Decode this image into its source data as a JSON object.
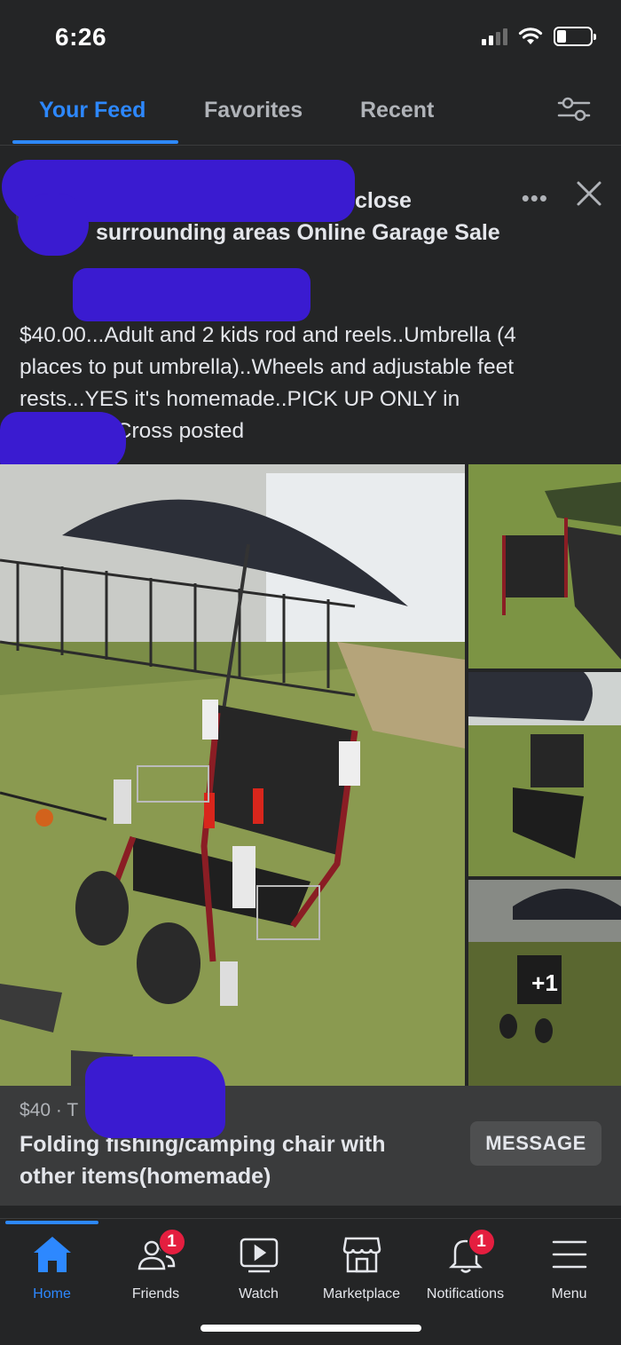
{
  "status_bar": {
    "time": "6:26"
  },
  "tabs": [
    {
      "label": "Your Feed",
      "active": true
    },
    {
      "label": "Favorites",
      "active": false
    },
    {
      "label": "Recent",
      "active": false
    }
  ],
  "post": {
    "group_line1": "close",
    "group_line2": "surrounding areas Online Garage Sale",
    "body_line1": "$40.00...Adult and 2 kids rod and reels..Umbrella (4",
    "body_line2": "places to put umbrella)..Wheels and adjustable feet",
    "body_line3": "rests...YES it's homemade..PICK UP ONLY in",
    "body_line4": ".Cross posted",
    "more_photos": "+1"
  },
  "listing": {
    "price": "$40 · T",
    "title": "Folding fishing/camping chair with other items(homemade)",
    "message_button": "MESSAGE"
  },
  "bottom_nav": [
    {
      "label": "Home",
      "icon": "home-icon",
      "active": true
    },
    {
      "label": "Friends",
      "icon": "friends-icon",
      "badge": "1"
    },
    {
      "label": "Watch",
      "icon": "watch-icon"
    },
    {
      "label": "Marketplace",
      "icon": "marketplace-icon"
    },
    {
      "label": "Notifications",
      "icon": "bell-icon",
      "badge": "1"
    },
    {
      "label": "Menu",
      "icon": "menu-icon"
    }
  ],
  "colors": {
    "accent": "#2d88ff",
    "badge": "#e41e3f",
    "redaction": "#3a1bd0"
  }
}
